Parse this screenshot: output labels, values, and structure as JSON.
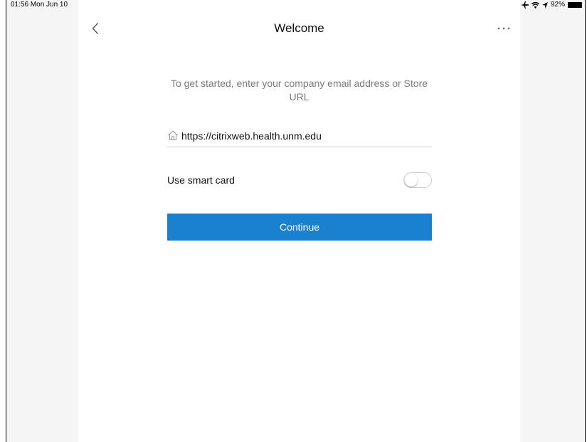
{
  "status_bar": {
    "time_date": "01:56  Mon Jun 10",
    "battery_percent": "92%",
    "icons": [
      "airplane-icon",
      "wifi-icon",
      "location-icon",
      "battery-icon"
    ]
  },
  "nav": {
    "title": "Welcome",
    "back_icon": "chevron-left-icon",
    "more_icon": "more-dots-icon"
  },
  "intro_text": "To get started, enter your company email address or Store URL",
  "url_field": {
    "icon": "home-icon",
    "value": "https://citrixweb.health.unm.edu"
  },
  "smart_card": {
    "label": "Use smart card",
    "enabled": false
  },
  "continue_label": "Continue",
  "colors": {
    "accent": "#1a81d0",
    "side_panel": "#f5f5f5",
    "intro_text": "#7a7a7a"
  }
}
